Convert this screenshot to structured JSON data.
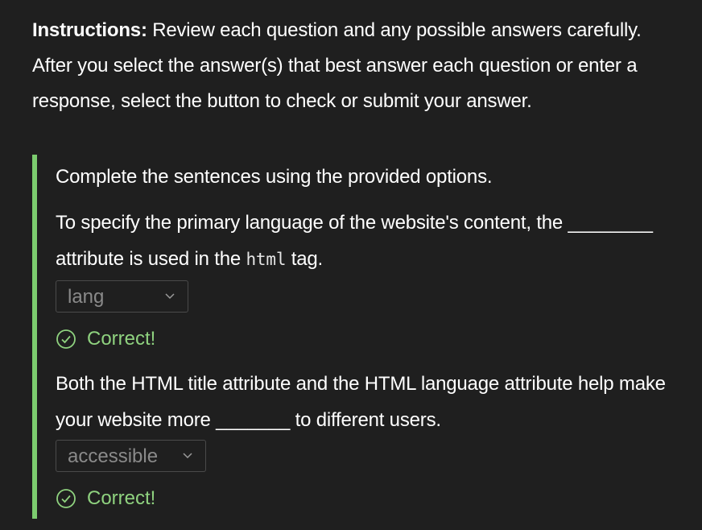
{
  "instructions": {
    "lead": "Instructions:",
    "text": " Review each question and any possible answers carefully. After you select the answer(s) that best answer each question or enter a response, select the button to check or submit your answer."
  },
  "question": {
    "prompt": "Complete the sentences using the provided options.",
    "items": [
      {
        "before": "To specify the primary language of the website's content, the ________ attribute is used in the ",
        "code": "html",
        "after": " tag.",
        "selected": "lang",
        "feedback": "Correct!"
      },
      {
        "before": "Both the HTML title attribute and the HTML language attribute help make your website more _______ to different users.",
        "selected": "accessible",
        "feedback": "Correct!"
      }
    ]
  },
  "colors": {
    "background": "#1f1f1f",
    "accent_border": "#7ccc6f",
    "success_text": "#8fd27f"
  },
  "icons": {
    "dropdown": "chevron-down-icon",
    "feedback": "check-circle-icon"
  }
}
